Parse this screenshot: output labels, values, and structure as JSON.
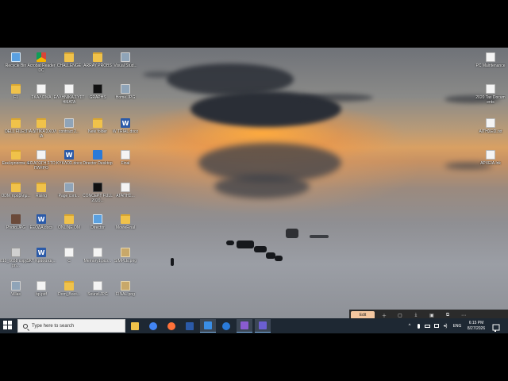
{
  "desktop": {
    "icons": [
      {
        "label": "Recycle Bin",
        "glyph": "pc"
      },
      {
        "label": "Acrobat Reader DC",
        "glyph": "chrome"
      },
      {
        "label": "CHALLENGE",
        "glyph": "folder"
      },
      {
        "label": "ARRAY PROBS",
        "glyph": "folder"
      },
      {
        "label": "Visual Stud...",
        "glyph": "img"
      },
      {
        "label": "F1",
        "glyph": "folder"
      },
      {
        "label": "ΣΚΑΛΙΣΜΑ",
        "glyph": "doc"
      },
      {
        "label": "ΕΛΛΗΝΙΚΑ ΣΥΣΤΗΜΑΤΑ",
        "glyph": "doc"
      },
      {
        "label": "GRAPHS",
        "glyph": "black"
      },
      {
        "label": "Home.JPG",
        "glyph": "img"
      },
      {
        "label": "DELL FILES",
        "glyph": "folder"
      },
      {
        "label": "ΓΙΑ ΔΙΤΙΚΑ ΣΧΟΛΙΑ",
        "glyph": "folder"
      },
      {
        "label": "contract 2...",
        "glyph": "img"
      },
      {
        "label": "New folder",
        "glyph": "folder"
      },
      {
        "label": "W TRIAL.docx",
        "glyph": "word"
      },
      {
        "label": "Εκκλησιαστικ οι",
        "glyph": "folder"
      },
      {
        "label": "ΕΙΣΑΓΩΓΗ ΣΤΟ ΠΛΗΡΟ",
        "glyph": "doc"
      },
      {
        "label": "ΚΥΚΛΟΣ.docx",
        "glyph": "word"
      },
      {
        "label": "Director Desktop",
        "glyph": "edge"
      },
      {
        "label": "Final",
        "glyph": "doc"
      },
      {
        "label": "ODM προβλήμ...",
        "glyph": "folder"
      },
      {
        "label": "Rising",
        "glyph": "folder"
      },
      {
        "label": "Page cont...",
        "glyph": "img"
      },
      {
        "label": "CONCEPT FULL 2020...",
        "glyph": "black"
      },
      {
        "label": "ΑΓΑΠΗΣ...",
        "glyph": "doc"
      },
      {
        "label": "Photo.JPG",
        "glyph": "photo"
      },
      {
        "label": "ΕΞΟΔΑ.docx",
        "glyph": "word"
      },
      {
        "label": "ONLINE OM",
        "glyph": "folder"
      },
      {
        "label": "Director",
        "glyph": "pc"
      },
      {
        "label": "MovieFinal",
        "glyph": "folder"
      },
      {
        "label": "810_6658 copy 2.pn...",
        "glyph": "gray"
      },
      {
        "label": "SKT Κρασατας...",
        "glyph": "word"
      },
      {
        "label": "C",
        "glyph": "doc"
      },
      {
        "label": "Memory1.pco...",
        "glyph": "doc"
      },
      {
        "label": "SIMPLE.png",
        "glyph": "zip"
      },
      {
        "label": "Villas",
        "glyph": "img"
      },
      {
        "label": "bp.pdf",
        "glyph": "doc"
      },
      {
        "label": "Dom_Boot...",
        "glyph": "folder"
      },
      {
        "label": "Sound.JPG",
        "glyph": "doc"
      },
      {
        "label": "FINAL.png",
        "glyph": "zip"
      },
      {
        "label": "PC Maintenance",
        "glyph": "doc"
      },
      {
        "label": "2020 Tax Documents",
        "glyph": "doc"
      },
      {
        "label": "ΑΙΤΗΣΕΙΣ.txt",
        "glyph": "doc"
      },
      {
        "label": "ΑΡΧΕΙΑ.lnk",
        "glyph": "doc"
      }
    ]
  },
  "snip": {
    "edit_label": "Edit",
    "buttons": [
      "＋",
      "▢",
      "⤓",
      "▣",
      "⧉",
      "⋯"
    ]
  },
  "taskbar": {
    "search_placeholder": "Type here to search",
    "apps": [
      {
        "name": "file-explorer",
        "color": "#f0c24a",
        "active": false
      },
      {
        "name": "chrome",
        "color": "#4285f4",
        "active": false
      },
      {
        "name": "firefox",
        "color": "#ff7139",
        "active": false
      },
      {
        "name": "word",
        "color": "#2b5aa8",
        "active": false
      },
      {
        "name": "director",
        "color": "#3a8ee6",
        "active": true
      },
      {
        "name": "edge",
        "color": "#2a7ad8",
        "active": false
      },
      {
        "name": "visual-studio",
        "color": "#8a5cd0",
        "active": true
      },
      {
        "name": "screen-recorder",
        "color": "#6b5fd0",
        "active": true
      }
    ],
    "tray": {
      "chevron": "^",
      "language": "ENG",
      "time": "6:15 PM",
      "date": "8/27/2026"
    }
  }
}
